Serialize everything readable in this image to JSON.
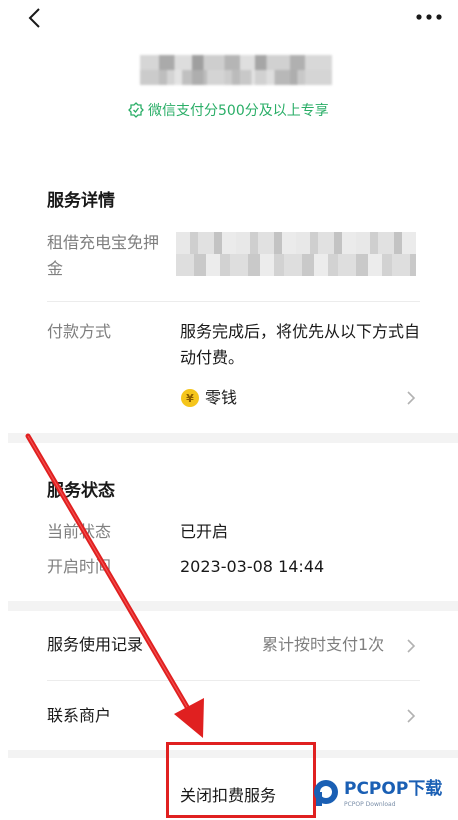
{
  "header": {
    "back_icon": "back-chevron-icon",
    "more_icon": "more-dots-icon"
  },
  "subtitle": {
    "text": "微信支付分500分及以上专享",
    "color": "#2aae67"
  },
  "service_details": {
    "title": "服务详情",
    "item_label": "租借充电宝免押金",
    "payment_label": "付款方式",
    "payment_desc": "服务完成后，将优先从以下方式自动付费。",
    "payment_method": "零钱",
    "coin_symbol": "¥"
  },
  "service_status": {
    "title": "服务状态",
    "current_label": "当前状态",
    "current_value": "已开启",
    "opened_label": "开启时间",
    "opened_value": "2023-03-08 14:44"
  },
  "records": {
    "label": "服务使用记录",
    "value": "累计按时支付1次"
  },
  "contact": {
    "label": "联系商户"
  },
  "footer": {
    "close_label": "关闭扣费服务"
  },
  "watermark": {
    "brand": "PCPOP下载",
    "sub": "PCPOP Download"
  },
  "colors": {
    "highlight": "#e02020",
    "accent_green": "#2aae67"
  }
}
